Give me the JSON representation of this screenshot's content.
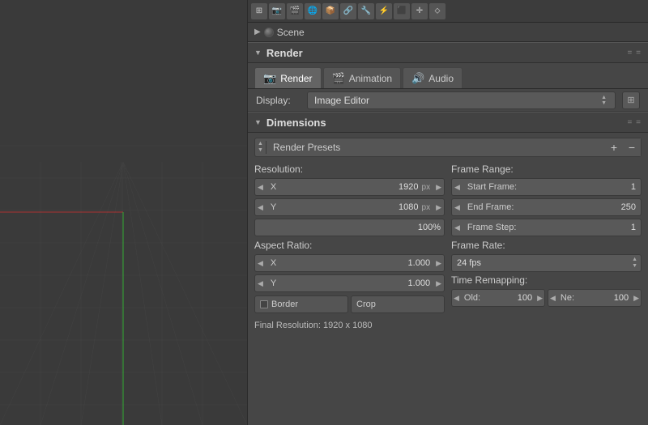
{
  "toolbar": {
    "icons": [
      "⊞",
      "📷",
      "🎬",
      "🌐",
      "📦",
      "🔗",
      "🔧",
      "⚡",
      "⬛",
      "✛",
      "⬦"
    ]
  },
  "scene": {
    "label": "Scene"
  },
  "render_section": {
    "title": "Render",
    "tabs": [
      {
        "label": "Render",
        "icon": "📷"
      },
      {
        "label": "Animation",
        "icon": "🎬"
      },
      {
        "label": "Audio",
        "icon": "🔊"
      }
    ],
    "display_label": "Display:",
    "display_value": "Image Editor",
    "dots": "..."
  },
  "dimensions": {
    "title": "Dimensions",
    "presets_label": "Render Presets",
    "resolution_label": "Resolution:",
    "x_label": "X",
    "x_value": "1920",
    "x_unit": "px",
    "y_label": "Y",
    "y_value": "1080",
    "y_unit": "px",
    "percent_value": "100%",
    "aspect_label": "Aspect Ratio:",
    "ax_label": "X",
    "ax_value": "1.000",
    "ay_label": "Y",
    "ay_value": "1.000",
    "border_label": "Border",
    "crop_label": "Crop",
    "final_res": "Final Resolution: 1920 x 1080"
  },
  "frame_range": {
    "title": "Frame Range:",
    "start_label": "Start Frame:",
    "start_value": "1",
    "end_label": "End Frame:",
    "end_value": "250",
    "step_label": "Frame Step:",
    "step_value": "1",
    "rate_title": "Frame Rate:",
    "rate_value": "24 fps",
    "remap_title": "Time Remapping:",
    "old_label": "Old:",
    "old_value": "100",
    "ne_label": "Ne:",
    "ne_value": "100"
  }
}
